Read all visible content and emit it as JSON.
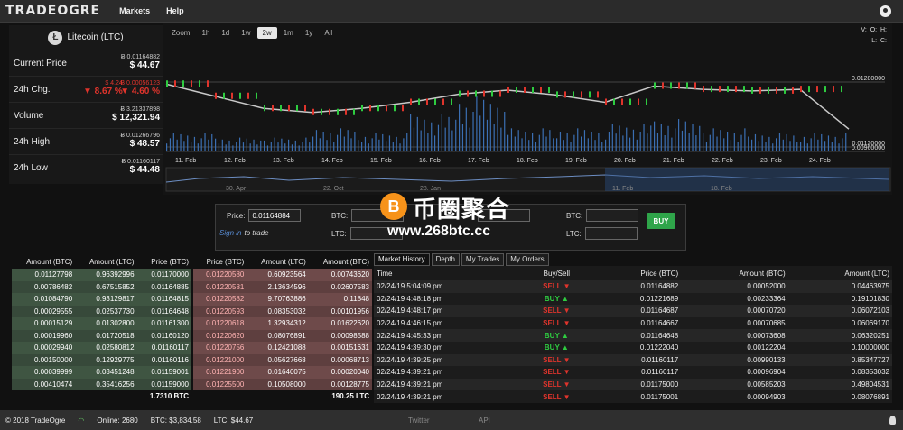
{
  "nav": {
    "logo": "TRADEOGRE",
    "items": [
      "Markets",
      "Help"
    ]
  },
  "coin": {
    "name": "Litecoin (LTC)",
    "symbol": "Ł"
  },
  "stats": {
    "price": {
      "label": "Current Price",
      "btc": "Ƀ 0.01164882",
      "usd": "$ 44.67"
    },
    "change": {
      "label": "24h Chg.",
      "usd_delta": "$ 4.24",
      "usd_pct": "▼ 8.67 %",
      "btc_delta": "Ƀ 0.00056123",
      "btc_pct": "▼ 4.60 %"
    },
    "volume": {
      "label": "Volume",
      "btc": "Ƀ 3.21337898",
      "usd": "$ 12,321.94"
    },
    "high": {
      "label": "24h High",
      "btc": "Ƀ 0.01266796",
      "usd": "$ 48.57"
    },
    "low": {
      "label": "24h Low",
      "btc": "Ƀ 0.01160117",
      "usd": "$ 44.48"
    }
  },
  "chart": {
    "zoom_label": "Zoom",
    "zoom_options": [
      "1h",
      "1d",
      "1w",
      "2w",
      "1m",
      "1y",
      "All"
    ],
    "zoom_active": "2w",
    "ohlc": {
      "o": "O:",
      "h": "H:",
      "l": "L:",
      "c": "C:",
      "v": "V:"
    },
    "price_ticks": [
      "0.01280000",
      "0.01120000",
      "0.00960000"
    ],
    "date_ticks": [
      "11. Feb",
      "12. Feb",
      "13. Feb",
      "14. Feb",
      "15. Feb",
      "16. Feb",
      "17. Feb",
      "18. Feb",
      "19. Feb",
      "20. Feb",
      "21. Feb",
      "22. Feb",
      "23. Feb",
      "24. Feb"
    ],
    "navigator_ticks": [
      "30. Apr",
      "22. Oct",
      "28. Jan",
      "11. Feb",
      "18. Feb"
    ]
  },
  "chart_data": {
    "type": "line",
    "title": "",
    "x": [
      "11. Feb",
      "12. Feb",
      "13. Feb",
      "14. Feb",
      "15. Feb",
      "16. Feb",
      "17. Feb",
      "18. Feb",
      "19. Feb",
      "20. Feb",
      "21. Feb",
      "22. Feb",
      "23. Feb",
      "24. Feb",
      "25. Feb"
    ],
    "series": [
      {
        "values": [
          0.01275,
          0.01245,
          0.01215,
          0.01205,
          0.01215,
          0.0123,
          0.0125,
          0.0126,
          0.01248,
          0.0123,
          0.0127,
          0.01262,
          0.01258,
          0.01262,
          0.01164
        ]
      }
    ],
    "volume": [
      4,
      3,
      3,
      5,
      4,
      8,
      12,
      5,
      5,
      6,
      7,
      5,
      4,
      4,
      3
    ],
    "ylim": [
      0.0096,
      0.0132
    ]
  },
  "order_form": {
    "price_label": "Price:",
    "price_value": "0.01164884",
    "btc_label": "BTC:",
    "ltc_label": "LTC:",
    "signin_link": "Sign in",
    "signin_suffix": "to trade",
    "buy_label": "BUY"
  },
  "watermark": {
    "title": "币圈聚合",
    "url": "www.268btc.cc",
    "coin": "B"
  },
  "buy_orders": {
    "headers": [
      "Amount (BTC)",
      "Amount (LTC)",
      "Price (BTC)"
    ],
    "rows": [
      [
        "0.01127798",
        "0.96392996",
        "0.01170000"
      ],
      [
        "0.00786482",
        "0.67515852",
        "0.01164885"
      ],
      [
        "0.01084790",
        "0.93129817",
        "0.01164815"
      ],
      [
        "0.00029555",
        "0.02537730",
        "0.01164648"
      ],
      [
        "0.00015129",
        "0.01302800",
        "0.01161300"
      ],
      [
        "0.00019960",
        "0.01720518",
        "0.01160120"
      ],
      [
        "0.00029940",
        "0.02580812",
        "0.01160117"
      ],
      [
        "0.00150000",
        "0.12929775",
        "0.01160116"
      ],
      [
        "0.00039999",
        "0.03451248",
        "0.01159001"
      ],
      [
        "0.00410474",
        "0.35416256",
        "0.01159000"
      ]
    ],
    "total": "1.7310 BTC"
  },
  "sell_orders": {
    "headers": [
      "Price (BTC)",
      "Amount (LTC)",
      "Amount (BTC)"
    ],
    "rows": [
      [
        "0.01220580",
        "0.60923564",
        "0.00743620"
      ],
      [
        "0.01220581",
        "2.13634596",
        "0.02607583"
      ],
      [
        "0.01220582",
        "9.70763886",
        "0.11848"
      ],
      [
        "0.01220593",
        "0.08353032",
        "0.00101956"
      ],
      [
        "0.01220618",
        "1.32934312",
        "0.01622620"
      ],
      [
        "0.01220620",
        "0.08076891",
        "0.00098588"
      ],
      [
        "0.01220756",
        "0.12421088",
        "0.00151631"
      ],
      [
        "0.01221000",
        "0.05627668",
        "0.00068713"
      ],
      [
        "0.01221900",
        "0.01640075",
        "0.00020040"
      ],
      [
        "0.01225500",
        "0.10508000",
        "0.00128775"
      ]
    ],
    "total": "190.25 LTC"
  },
  "history": {
    "tabs": [
      "Market History",
      "Depth",
      "My Trades",
      "My Orders"
    ],
    "headers": [
      "Time",
      "Buy/Sell",
      "Price (BTC)",
      "Amount (BTC)",
      "Amount (LTC)"
    ],
    "rows": [
      [
        "02/24/19 5:04:09 pm",
        "SELL ▼",
        "0.01164882",
        "0.00052000",
        "0.04463975"
      ],
      [
        "02/24/19 4:48:18 pm",
        "BUY ▲",
        "0.01221689",
        "0.00233364",
        "0.19101830"
      ],
      [
        "02/24/19 4:48:17 pm",
        "SELL ▼",
        "0.01164687",
        "0.00070720",
        "0.06072103"
      ],
      [
        "02/24/19 4:46:15 pm",
        "SELL ▼",
        "0.01164667",
        "0.00070685",
        "0.06069170"
      ],
      [
        "02/24/19 4:45:33 pm",
        "BUY ▲",
        "0.01164648",
        "0.00073608",
        "0.06320251"
      ],
      [
        "02/24/19 4:39:30 pm",
        "BUY ▲",
        "0.01222040",
        "0.00122204",
        "0.10000000"
      ],
      [
        "02/24/19 4:39:25 pm",
        "SELL ▼",
        "0.01160117",
        "0.00990133",
        "0.85347727"
      ],
      [
        "02/24/19 4:39:21 pm",
        "SELL ▼",
        "0.01160117",
        "0.00096904",
        "0.08353032"
      ],
      [
        "02/24/19 4:39:21 pm",
        "SELL ▼",
        "0.01175000",
        "0.00585203",
        "0.49804531"
      ],
      [
        "02/24/19 4:39:21 pm",
        "SELL ▼",
        "0.01175001",
        "0.00094903",
        "0.08076891"
      ]
    ]
  },
  "footer": {
    "copyright": "© 2018 TradeOgre",
    "online": "Online: 2680",
    "btc": "BTC: $3,834.58",
    "ltc": "LTC: $44.67",
    "twitter": "Twitter",
    "api": "API"
  },
  "colors": {
    "buy": "#2ecc40",
    "sell": "#e0342c",
    "accent": "#2fa54a"
  }
}
